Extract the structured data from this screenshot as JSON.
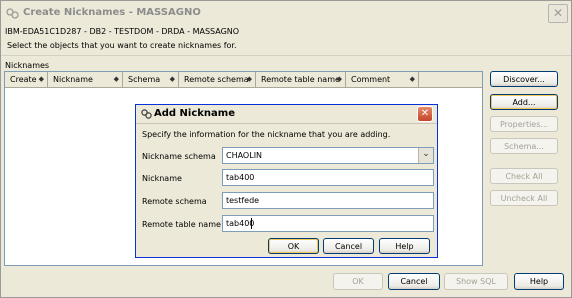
{
  "window": {
    "title": "Create Nicknames - MASSAGNO",
    "subtitle": "IBM-EDA51C1D287 - DB2 - TESTDOM - DRDA - MASSAGNO",
    "instructions": "Select the objects that you want to create nicknames for.",
    "close_glyph": "✕"
  },
  "table": {
    "label": "Nicknames",
    "columns": [
      "Create",
      "Nickname",
      "Schema",
      "Remote schema",
      "Remote table name",
      "Comment"
    ],
    "sort_glyph": "◆",
    "rows": []
  },
  "side_buttons": {
    "discover": "Discover...",
    "add": "Add...",
    "properties": "Properties...",
    "schema": "Schema...",
    "check_all": "Check All",
    "uncheck_all": "Uncheck All"
  },
  "bottom_buttons": {
    "ok": "OK",
    "cancel": "Cancel",
    "show_sql": "Show SQL",
    "help": "Help"
  },
  "dialog": {
    "title": "Add Nickname",
    "instructions": "Specify the information for the nickname that you are adding.",
    "close_glyph": "✕",
    "fields": {
      "nickname_schema": {
        "label": "Nickname schema",
        "value": "CHAOLIN"
      },
      "nickname": {
        "label": "Nickname",
        "value": "tab400"
      },
      "remote_schema": {
        "label": "Remote schema",
        "value": "testfede"
      },
      "remote_table_name": {
        "label": "Remote table name",
        "value": "tab400"
      }
    },
    "combo_arrow": "⌄",
    "buttons": {
      "ok": "OK",
      "cancel": "Cancel",
      "help": "Help"
    }
  },
  "colors": {
    "window_bg": "#ECE9D8",
    "dialog_border": "#0831D9",
    "close_red": "#C5452A",
    "field_border": "#7F9DB9"
  }
}
